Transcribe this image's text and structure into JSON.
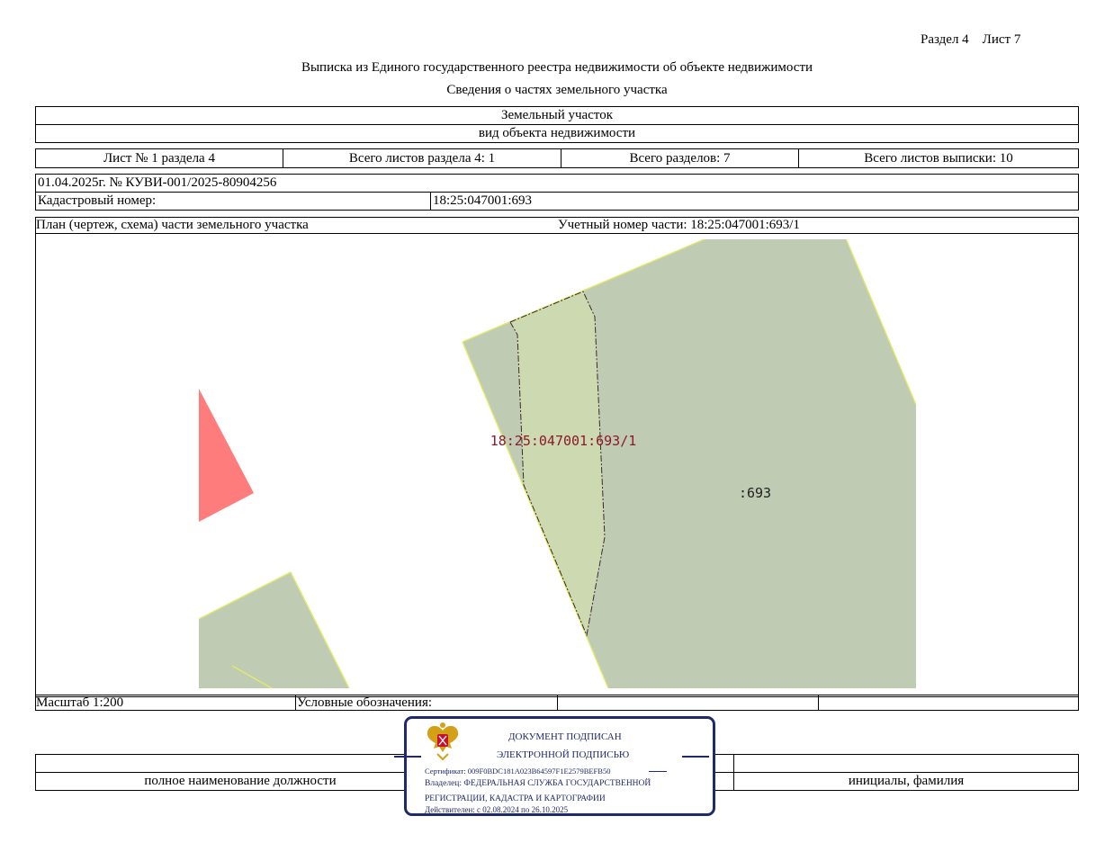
{
  "header": {
    "section_sheet": "Раздел 4    Лист 7",
    "title": "Выписка из Единого государственного реестра недвижимости об объекте недвижимости",
    "subtitle": "Сведения о частях земельного участка"
  },
  "object": {
    "type": "Земельный участок",
    "type_caption": "вид объекта недвижимости"
  },
  "sheets": {
    "sheet_no": "Лист № 1 раздела 4",
    "total_section": "Всего листов раздела 4: 1",
    "total_sections": "Всего разделов: 7",
    "total_extract": "Всего листов выписки: 10"
  },
  "document": {
    "date_number": "01.04.2025г. № КУВИ-001/2025-80904256",
    "cadastral_label": "Кадастровый номер:",
    "cadastral_value": "18:25:047001:693"
  },
  "plan": {
    "title": "План (чертеж, схема) части земельного участка",
    "part_number": "Учетный номер части: 18:25:047001:693/1",
    "label_part": "18:25:047001:693/1",
    "label_parcel": ":693",
    "colors": {
      "parcel_fill": "#c0cbb4",
      "part_fill": "#cdd9b1",
      "boundary": "#e2ea6a",
      "red_area": "#ff7c7c",
      "label_part": "#8b1a2b"
    }
  },
  "footer": {
    "scale": "Масштаб 1:200",
    "legend": "Условные обозначения:",
    "position_caption": "полное наименование должности",
    "name_caption": "инициалы, фамилия"
  },
  "stamp": {
    "line1": "ДОКУМЕНТ ПОДПИСАН",
    "line2": "ЭЛЕКТРОННОЙ ПОДПИСЬЮ",
    "certificate": "Сертификат: 009F0BDC181A023B64597F1E2579BEFB50",
    "owner1": "Владелец: ФЕДЕРАЛЬНАЯ СЛУЖБА ГОСУДАРСТВЕННОЙ",
    "owner2": "РЕГИСТРАЦИИ, КАДАСТРА И КАРТОГРАФИИ",
    "valid": "Действителен: с 02.08.2024 по 26.10.2025",
    "color": "#1f2a6b"
  }
}
